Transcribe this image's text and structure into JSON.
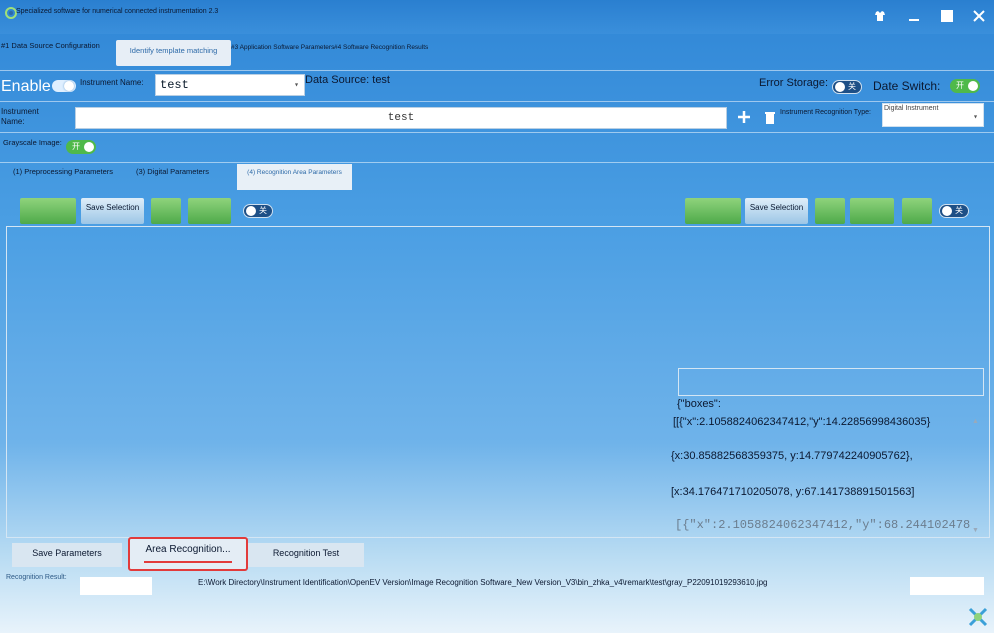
{
  "window": {
    "title": "Specialized software for numerical connected instrumentation 2.3"
  },
  "main_tabs": [
    {
      "label": "#1 Data Source Configuration"
    },
    {
      "label": "Identify template matching"
    },
    {
      "label": "#3 Application Software Parameters"
    },
    {
      "label": "#4 Software Recognition Results"
    }
  ],
  "row1": {
    "enable_label": "Enable",
    "instrument_name_label": "Instrument Name:",
    "instrument_name_value": "test",
    "data_source_label": "Data Source: test",
    "error_storage_label": "Error Storage:",
    "error_storage_toggle": "关",
    "date_switch_label": "Date Switch:",
    "date_switch_toggle": "开"
  },
  "row2": {
    "instrument_name_label": "Instrument Name:",
    "instrument_name_value": "test",
    "recognition_type_label": "Instrument Recognition Type:",
    "recognition_type_value": "Digital Instrument"
  },
  "row3": {
    "grayscale_label": "Grayscale Image:",
    "grayscale_toggle": "开"
  },
  "sub_tabs": [
    {
      "label": "(1) Preprocessing Parameters"
    },
    {
      "label": "(3) Digital Parameters"
    },
    {
      "label": "(4) Recognition Area Parameters"
    }
  ],
  "toolbar": {
    "save_selection": "Save Selection",
    "toggle_left": "关",
    "toggle_right": "关"
  },
  "json_output": {
    "lines": [
      "{\"boxes\":",
      "[[{\"x\":2.1058824062347412,\"y\":14.22856998436035}",
      "{x:30.85882568359375, y:14.779742240905762},",
      "[x:34.176471710205078, y:67.141738891501563]",
      "[{\"x\":2.1058824062347412,\"y\":68.244102478"
    ]
  },
  "bottom": {
    "save_parameters": "Save Parameters",
    "area_recognition": "Area Recognition...",
    "recognition_test": "Recognition Test",
    "recognition_result_label": "Recognition Result:",
    "file_path": "E:\\Work Directory\\Instrument Identification\\OpenEV Version\\Image Recognition Software_New Version_V3\\bin_zhka_v4\\remark\\test\\gray_P22091019293610.jpg"
  }
}
